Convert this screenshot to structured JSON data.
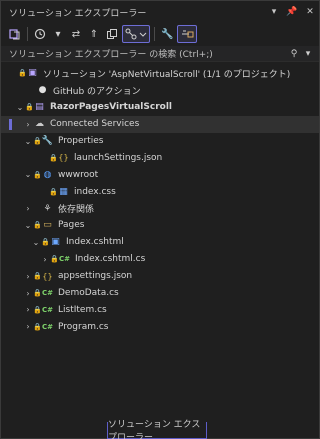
{
  "window": {
    "title": "ソリューション エクスプローラー",
    "controls": {
      "dropdown_icon": "chevron-down-icon",
      "pin_icon": "pin-icon",
      "close_icon": "close-icon"
    }
  },
  "toolbar": {
    "buttons": [
      {
        "name": "switch-views-icon"
      },
      {
        "name": "history-icon"
      },
      {
        "name": "sync-icon"
      },
      {
        "name": "collapse-all-icon"
      },
      {
        "name": "copy-icon"
      },
      {
        "name": "pending-changes-filter-icon"
      },
      {
        "name": "properties-icon"
      },
      {
        "name": "preview-icon"
      }
    ]
  },
  "search": {
    "placeholder": "ソリューション エクスプローラー の検索 (Ctrl+;)"
  },
  "tree": {
    "solution_label": "ソリューション 'AspNetVirtualScroll' (1/1 のプロジェクト)",
    "github_label": "GitHub のアクション",
    "project_label": "RazorPagesVirtualScroll",
    "connected_services_label": "Connected Services",
    "properties_label": "Properties",
    "launch_settings_label": "launchSettings.json",
    "wwwroot_label": "wwwroot",
    "index_css_label": "index.css",
    "dependencies_label": "依存関係",
    "pages_label": "Pages",
    "index_cshtml_label": "Index.cshtml",
    "index_cshtml_cs_label": "Index.cshtml.cs",
    "appsettings_label": "appsettings.json",
    "demodata_label": "DemoData.cs",
    "listitem_label": "ListItem.cs",
    "program_label": "Program.cs",
    "cs_icon_text": "C#"
  },
  "bottom_tab": {
    "label": "ソリューション エクスプローラー"
  },
  "colors": {
    "background": "#1f1f1f",
    "accent": "#6d6dd6",
    "csharp": "#7ed36b",
    "folder": "#dcb862"
  }
}
